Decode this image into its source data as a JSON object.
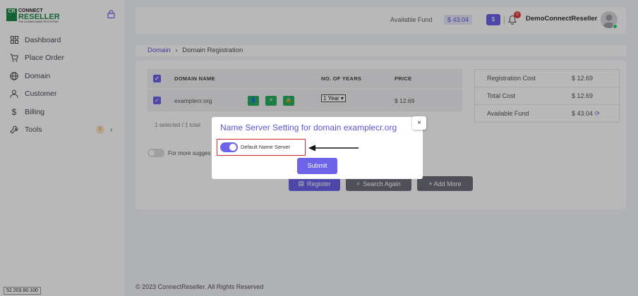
{
  "logo": {
    "box_text": "CR",
    "line1": "CONNECT",
    "line2": "RESELLER",
    "line3": "THE DOMAIN NAME REGISTRAR"
  },
  "sidebar": {
    "items": [
      {
        "label": "Dashboard",
        "icon": "grid-icon"
      },
      {
        "label": "Place Order",
        "icon": "cart-icon"
      },
      {
        "label": "Domain",
        "icon": "globe-icon"
      },
      {
        "label": "Customer",
        "icon": "user-icon"
      },
      {
        "label": "Billing",
        "icon": "dollar-icon"
      },
      {
        "label": "Tools",
        "icon": "wrench-icon",
        "badge": "9"
      }
    ]
  },
  "ip": "52.203.60.100",
  "header": {
    "fund_label": "Available Fund",
    "fund_value": "$ 43.04",
    "dollar_button": "$",
    "notification_count": "0",
    "username": "DemoConnectReseller"
  },
  "breadcrumb": {
    "link": "Domain",
    "sep": "›",
    "current": "Domain Registration"
  },
  "table": {
    "headers": [
      "DOMAIN NAME",
      "NO. OF YEARS",
      "PRICE"
    ],
    "rows": [
      {
        "domain": "examplecr.org",
        "years": "1 Year",
        "price": "$ 12.69"
      }
    ],
    "selected_info": "1 selected / 1 total"
  },
  "more_text": "For more sugges",
  "buttons": {
    "register": "Register",
    "search_again": "Search Again",
    "add_more": "+ Add More"
  },
  "summary": [
    {
      "label": "Registration Cost",
      "value": "$ 12.69"
    },
    {
      "label": "Total Cost",
      "value": "$ 12.69"
    },
    {
      "label": "Available Fund",
      "value": "$ 43.04"
    }
  ],
  "footer": "© 2023 ConnectReseller. All Rights Reserved",
  "modal": {
    "title": "Name Server Setting for domain examplecr.org",
    "close": "×",
    "toggle_label": "Default Name Server",
    "toggle_on": true,
    "submit": "Submit"
  },
  "colors": {
    "accent": "#6c63e8",
    "green": "#27ae60",
    "highlight": "#d62828"
  }
}
